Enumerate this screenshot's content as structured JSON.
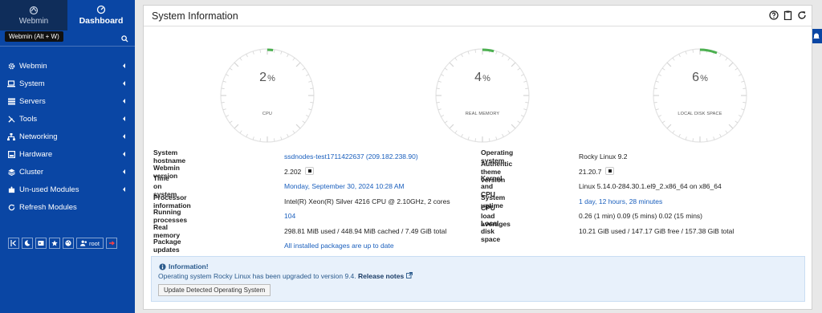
{
  "sidebar": {
    "tab_webmin": "Webmin",
    "tab_dashboard": "Dashboard",
    "tooltip": "Webmin (Alt + W)",
    "menu": [
      {
        "label": "Webmin",
        "icon": "gear-icon"
      },
      {
        "label": "System",
        "icon": "laptop-icon"
      },
      {
        "label": "Servers",
        "icon": "list-icon"
      },
      {
        "label": "Tools",
        "icon": "wrench-icon"
      },
      {
        "label": "Networking",
        "icon": "network-icon"
      },
      {
        "label": "Hardware",
        "icon": "hdd-icon"
      },
      {
        "label": "Cluster",
        "icon": "layers-icon"
      },
      {
        "label": "Un-used Modules",
        "icon": "puzzle-icon"
      },
      {
        "label": "Refresh Modules",
        "icon": "refresh-icon"
      }
    ],
    "bottom_user": "root",
    "accent": "#0a46a4"
  },
  "panel": {
    "title": "System Information"
  },
  "gauges": [
    {
      "value": "2",
      "unit": "%",
      "label": "CPU",
      "level": 0.02
    },
    {
      "value": "4",
      "unit": "%",
      "label": "REAL MEMORY",
      "level": 0.04
    },
    {
      "value": "6",
      "unit": "%",
      "label": "LOCAL DISK SPACE",
      "level": 0.06
    }
  ],
  "info_left": [
    {
      "key": "System hostname",
      "value": "ssdnodes-test1711422637 (209.182.238.90)",
      "link": true
    },
    {
      "key": "Webmin version",
      "value": "2.202",
      "link": false,
      "badge": true
    },
    {
      "key": "Time on system",
      "value": "Monday, September 30, 2024 10:28 AM",
      "link": true
    },
    {
      "key": "Processor information",
      "value": "Intel(R) Xeon(R) Silver 4216 CPU @ 2.10GHz, 2 cores",
      "link": false
    },
    {
      "key": "Running processes",
      "value": "104",
      "link": true
    },
    {
      "key": "Real memory",
      "value": "298.81 MiB used / 448.94 MiB cached / 7.49 GiB total",
      "link": false
    },
    {
      "key": "Package updates",
      "value": "All installed packages are up to date",
      "link": true
    }
  ],
  "info_right": [
    {
      "key": "Operating system",
      "value": "Rocky Linux 9.2",
      "link": false
    },
    {
      "key": "Authentic theme version",
      "value": "21.20.7",
      "link": false,
      "badge": true
    },
    {
      "key": "Kernel and CPU",
      "value": "Linux 5.14.0-284.30.1.el9_2.x86_64 on x86_64",
      "link": false
    },
    {
      "key": "System uptime",
      "value": "1 day, 12 hours, 28 minutes",
      "link": true
    },
    {
      "key": "CPU load averages",
      "value": "0.26 (1 min) 0.09 (5 mins) 0.02 (15 mins)",
      "link": false
    },
    {
      "key": "Local disk space",
      "value": "10.21 GiB used / 147.17 GiB free / 157.38 GiB total",
      "link": false
    }
  ],
  "notice": {
    "title": "Information!",
    "text": "Operating system Rocky Linux has been upgraded to version 9.4.",
    "link_text": "Release notes",
    "button": "Update Detected Operating System"
  },
  "gauge_color": "#4cb050"
}
